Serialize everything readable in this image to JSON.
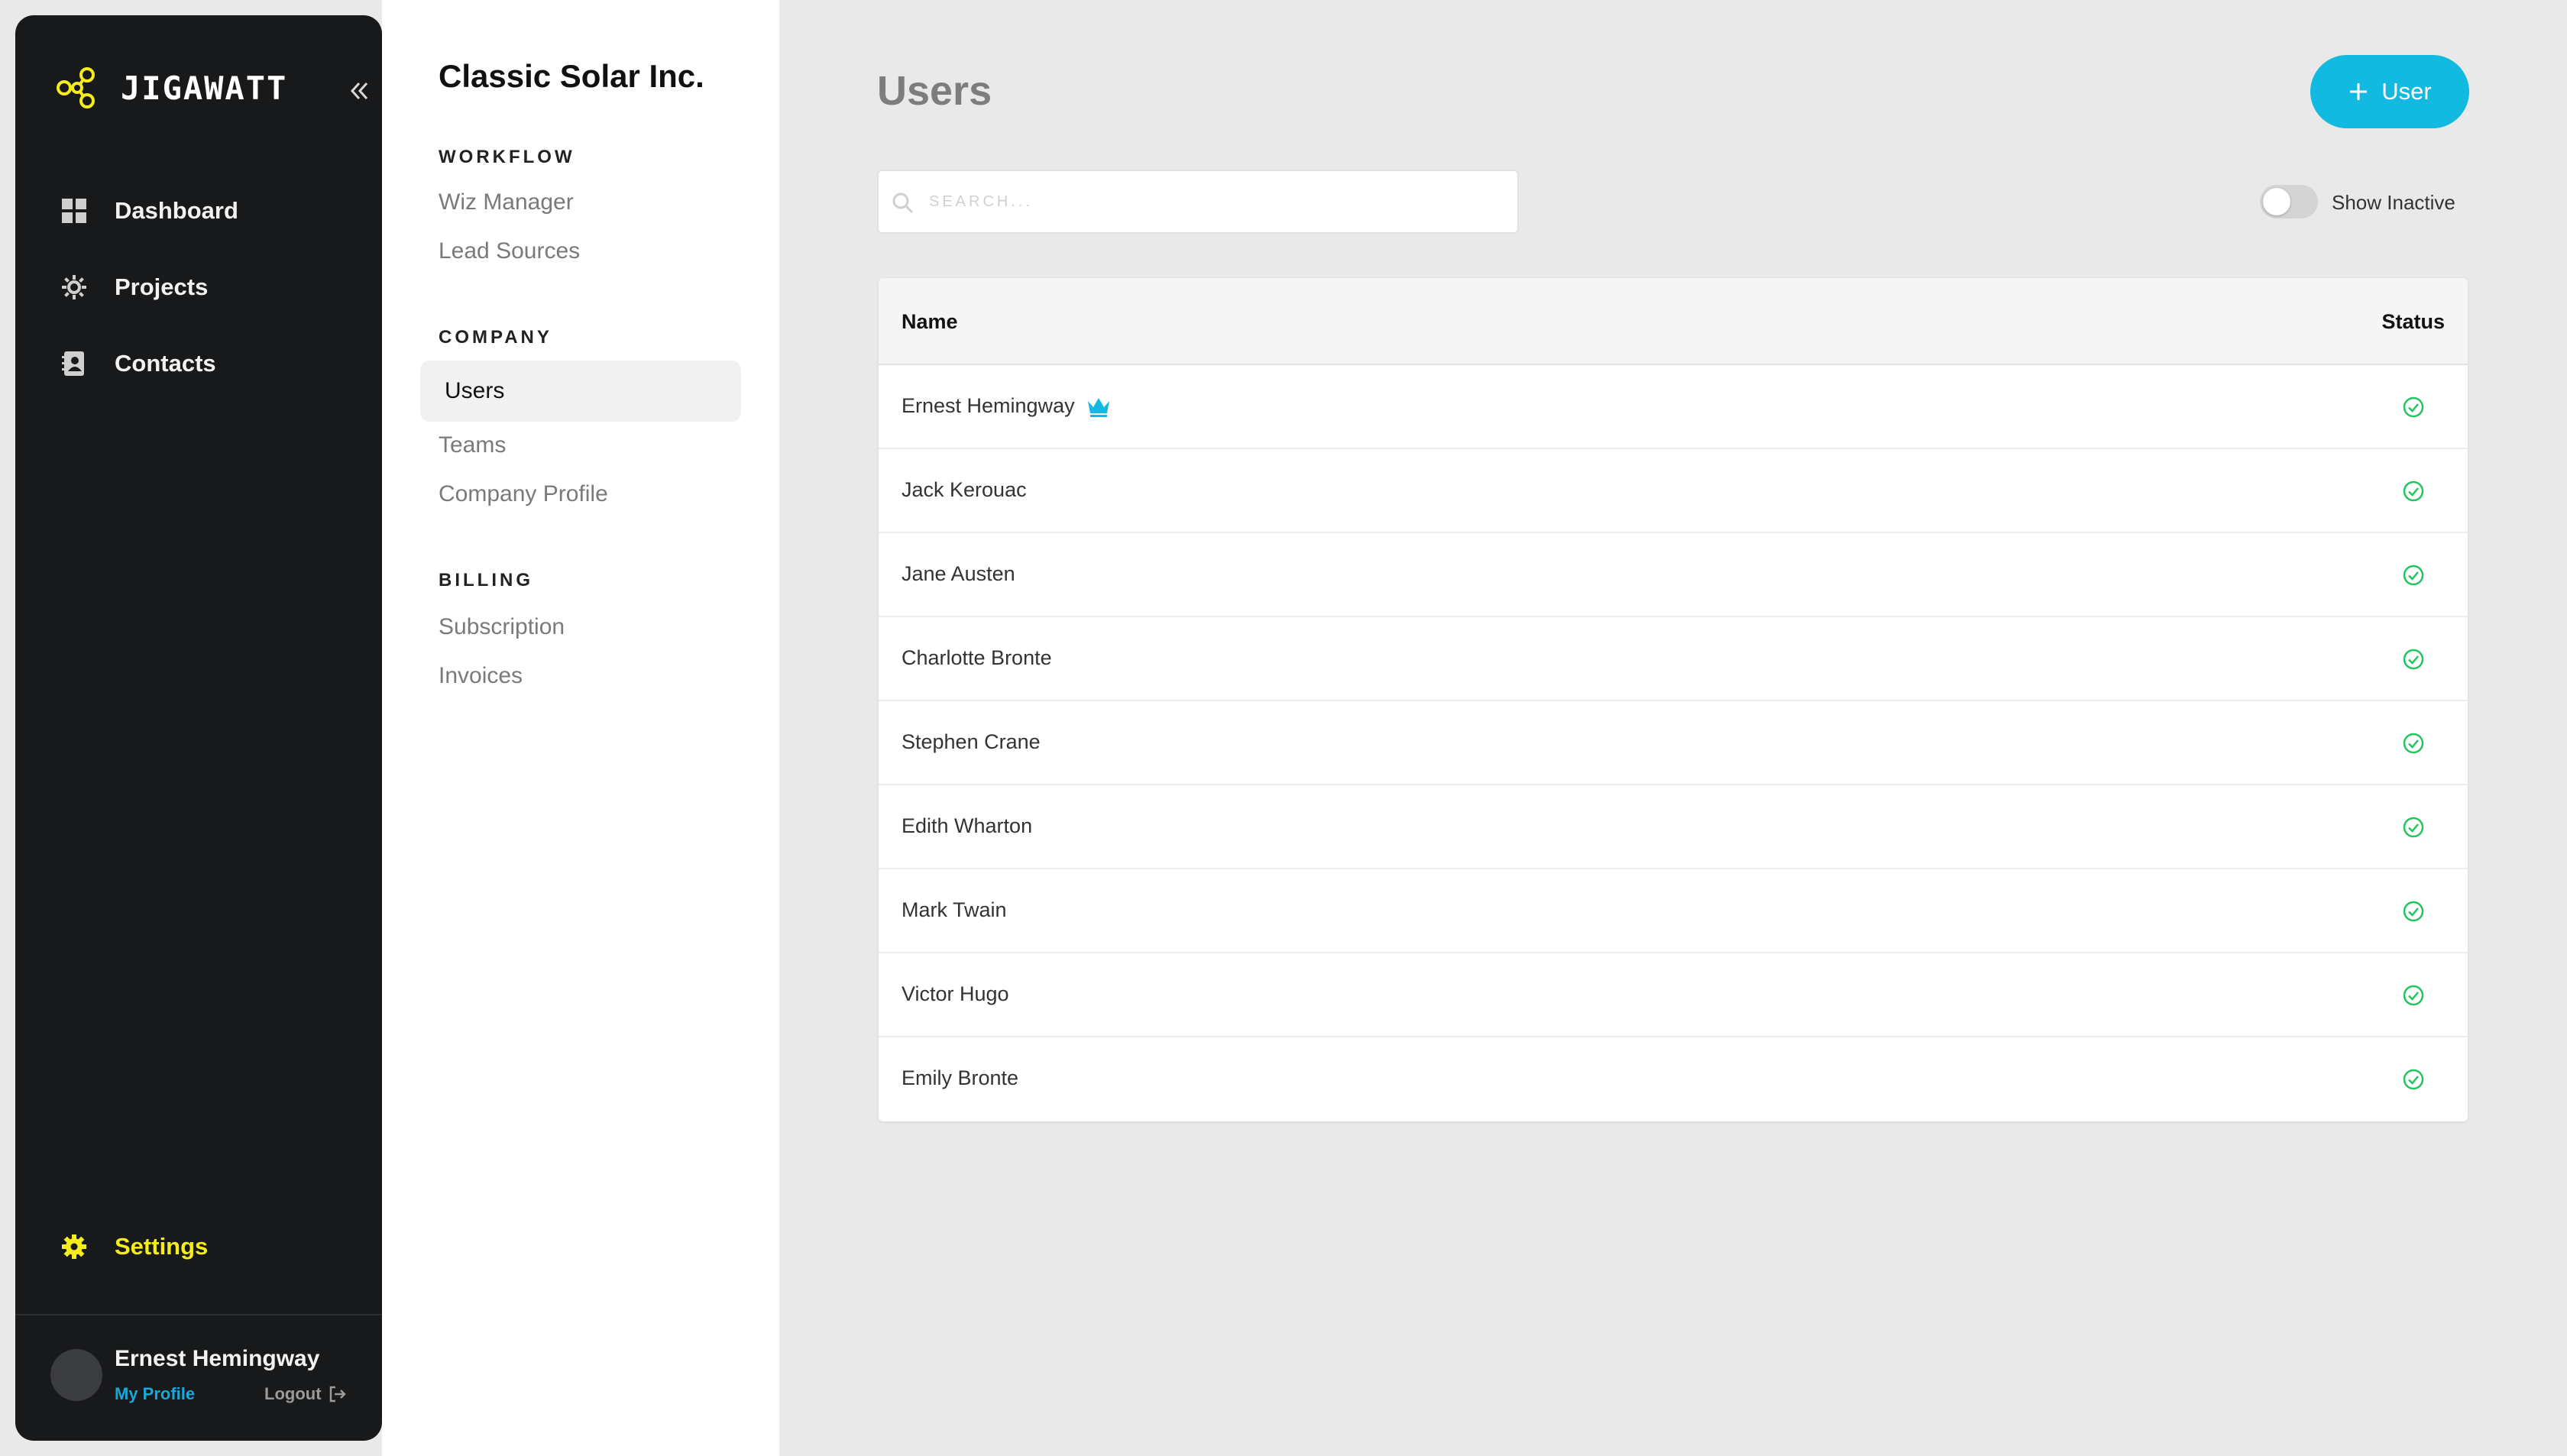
{
  "colors": {
    "accent": "#12b9e0",
    "brand_yellow": "#f4ec1b",
    "sidebar_bg": "#18191b",
    "status_active": "#22c55e",
    "link_blue": "#1aa7d6"
  },
  "sidebar": {
    "brand_name": "JIGAWATT",
    "brand_icon": "jigawatt-logo-icon",
    "collapse_icon": "double-chevron-left-icon",
    "items": [
      {
        "label": "Dashboard",
        "icon": "dashboard-grid-icon"
      },
      {
        "label": "Projects",
        "icon": "sun-gear-icon"
      },
      {
        "label": "Contacts",
        "icon": "contact-book-icon"
      }
    ],
    "settings": {
      "label": "Settings",
      "icon": "gear-icon"
    },
    "footer": {
      "user_name": "Ernest Hemingway",
      "my_profile": "My Profile",
      "logout": "Logout",
      "logout_icon": "logout-arrow-icon"
    }
  },
  "subnav": {
    "company_name": "Classic Solar Inc.",
    "sections": [
      {
        "heading": "WORKFLOW",
        "items": [
          "Wiz Manager",
          "Lead Sources"
        ]
      },
      {
        "heading": "COMPANY",
        "items": [
          "Users",
          "Teams",
          "Company Profile"
        ]
      },
      {
        "heading": "BILLING",
        "items": [
          "Subscription",
          "Invoices"
        ]
      }
    ],
    "active_item": "Users"
  },
  "main": {
    "title": "Users",
    "add_button": {
      "label": "User",
      "icon": "plus-icon"
    },
    "search": {
      "placeholder": "SEARCH...",
      "value": "",
      "icon": "search-icon"
    },
    "toggle": {
      "label": "Show Inactive",
      "checked": false
    },
    "table": {
      "columns": [
        "Name",
        "Status"
      ],
      "rows": [
        {
          "name": "Ernest Hemingway",
          "owner": true,
          "status": "active"
        },
        {
          "name": "Jack Kerouac",
          "owner": false,
          "status": "active"
        },
        {
          "name": "Jane Austen",
          "owner": false,
          "status": "active"
        },
        {
          "name": "Charlotte Bronte",
          "owner": false,
          "status": "active"
        },
        {
          "name": "Stephen Crane",
          "owner": false,
          "status": "active"
        },
        {
          "name": "Edith Wharton",
          "owner": false,
          "status": "active"
        },
        {
          "name": "Mark Twain",
          "owner": false,
          "status": "active"
        },
        {
          "name": "Victor Hugo",
          "owner": false,
          "status": "active"
        },
        {
          "name": "Emily Bronte",
          "owner": false,
          "status": "active"
        }
      ]
    }
  }
}
